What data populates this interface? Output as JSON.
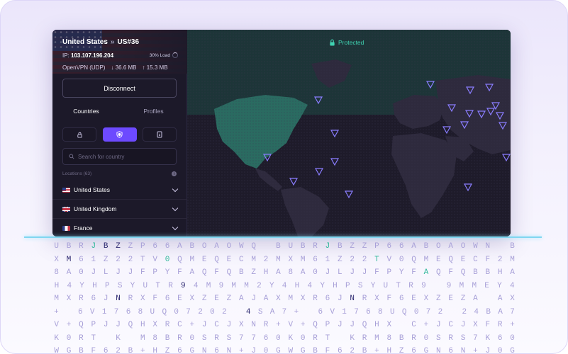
{
  "connection": {
    "country": "United States",
    "server": "US#36",
    "ip_label": "IP:",
    "ip": "103.107.196.204",
    "load": "30% Load",
    "protocol": "OpenVPN (UDP)",
    "download": "36.6 MB",
    "upload": "15.3 MB",
    "disconnect_label": "Disconnect"
  },
  "tabs": [
    "Countries",
    "Profiles"
  ],
  "search": {
    "placeholder": "Search for country"
  },
  "locations_label": "Locations (63)",
  "countries": [
    {
      "name": "United States",
      "flag": "us"
    },
    {
      "name": "United Kingdom",
      "flag": "uk"
    },
    {
      "name": "France",
      "flag": "fr"
    }
  ],
  "map": {
    "status": "Protected"
  },
  "colors": {
    "accent": "#6d4aff",
    "protected": "#3fd3b1",
    "map_land": "#2e2a3d",
    "map_connected": "#2a6b61"
  },
  "code_rows": [
    "UBRJBZZP66ABOAOWQ BUBRJBZZP66ABOAOWN B",
    "XM61Z22TV0QMEQECM2MXM61Z22TV0QMEQECF2M",
    "8A0JLJJFPYFAQFQBZHA8A0JLJJFPYFAQFQBBHA",
    "H4YHPSYUTR94M9MM2Y4H4YHPSYUTR9 9MMEY4",
    "MXR6JNRXF6EXZEZAJAXMXR6JNRXF6EXZEZA AX",
    "+ 6V1768UQ07202 4SA7+ 6V1768UQ072 24BA7",
    "V+QPJJQHXRC+JCJXNR+V+QPJJQHX C+JCJXFR+",
    "K0RT K M8BR0SRS7760K0RT KRM8BR0SRS7K60",
    "WGBF62B+HZ6GN6N+J0GWGBF62B+HZ6GN6N+J0G"
  ]
}
